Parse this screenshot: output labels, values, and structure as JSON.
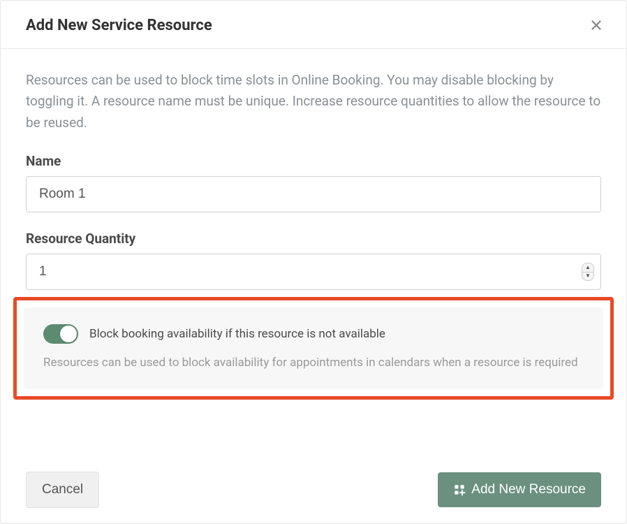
{
  "modal": {
    "title": "Add New Service Resource",
    "description": "Resources can be used to block time slots in Online Booking. You may disable blocking by toggling it. A resource name must be unique. Increase resource quantities to allow the resource to be reused."
  },
  "form": {
    "name_label": "Name",
    "name_value": "Room 1",
    "quantity_label": "Resource Quantity",
    "quantity_value": "1"
  },
  "toggle": {
    "label": "Block booking availability if this resource is not available",
    "description": "Resources can be used to block availability for appointments in calendars when a resource is required",
    "enabled": true
  },
  "buttons": {
    "cancel": "Cancel",
    "submit": "Add New Resource"
  },
  "colors": {
    "accent": "#6b9080",
    "highlight_border": "#e84a27"
  }
}
